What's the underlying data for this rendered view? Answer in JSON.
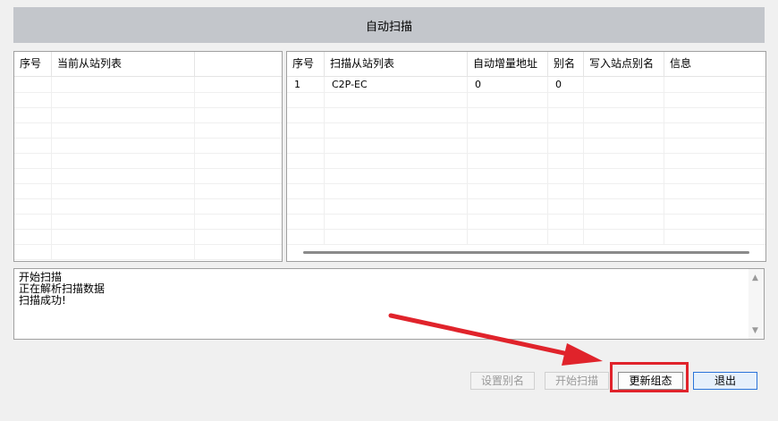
{
  "header": {
    "title": "自动扫描"
  },
  "left_table": {
    "columns": [
      "序号",
      "当前从站列表",
      ""
    ],
    "rows": []
  },
  "right_table": {
    "columns": [
      "序号",
      "扫描从站列表",
      "自动增量地址",
      "别名",
      "写入站点别名",
      "信息"
    ],
    "rows": [
      [
        "1",
        "C2P-EC",
        "0",
        "0",
        "",
        ""
      ]
    ]
  },
  "log": {
    "lines": [
      "开始扫描",
      "正在解析扫描数据",
      "扫描成功!"
    ]
  },
  "buttons": {
    "set_alias": "设置别名",
    "start_scan": "开始扫描",
    "update_config": "更新组态",
    "exit": "退出"
  },
  "annotation": {
    "color": "#e0232b"
  }
}
